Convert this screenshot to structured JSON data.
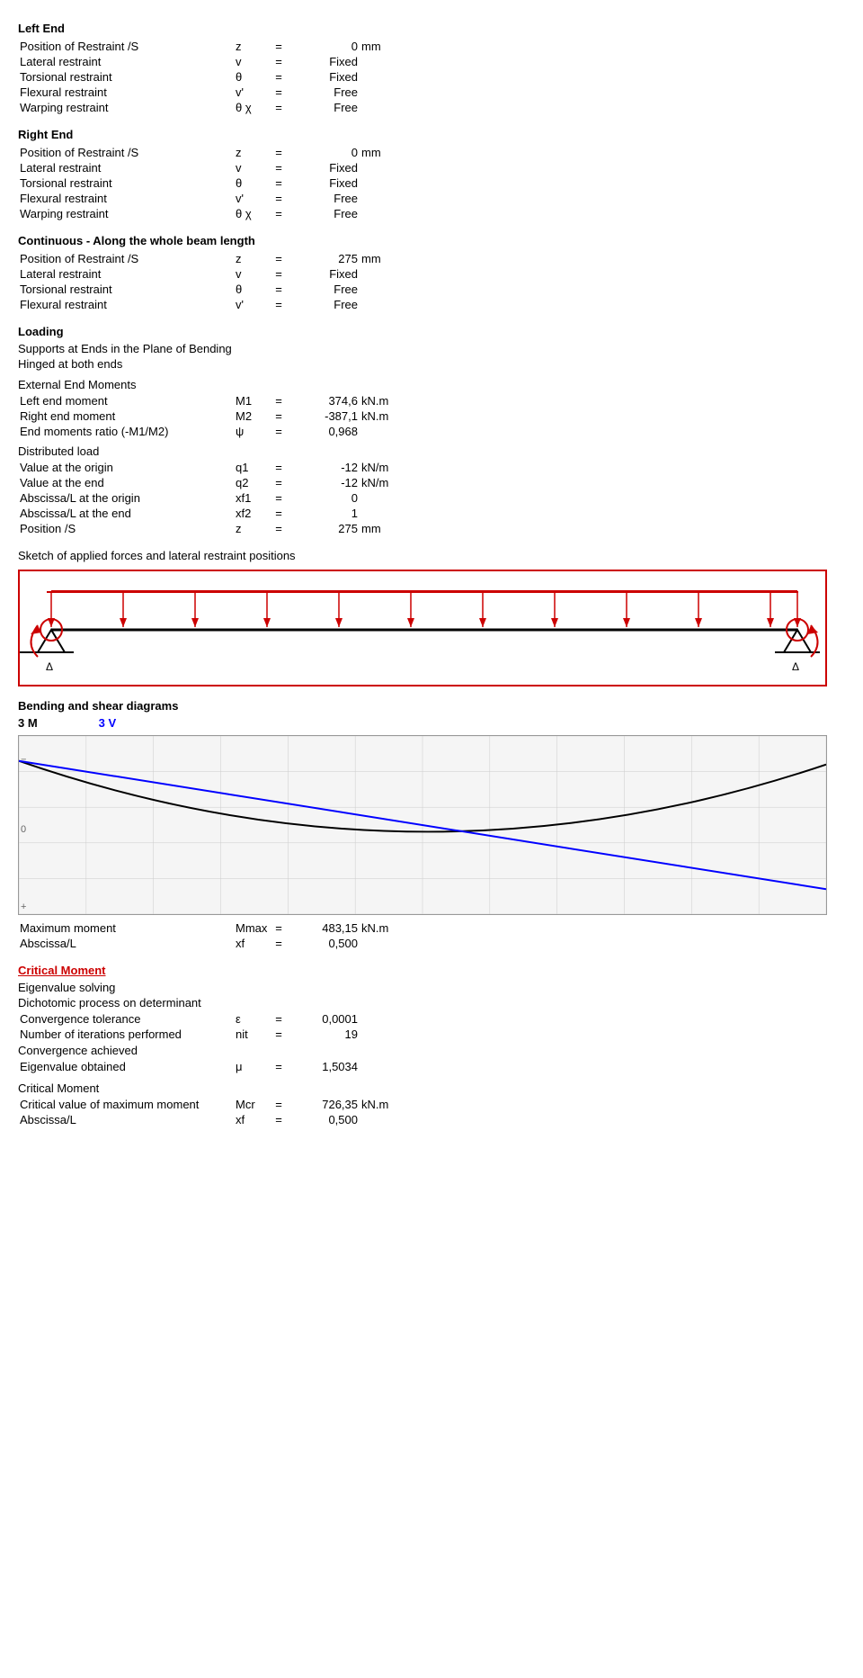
{
  "page": {
    "leftEnd": {
      "header": "Left End",
      "rows": [
        {
          "label": "Position of Restraint /S",
          "symbol": "z",
          "eq": "=",
          "value": "0",
          "unit": "mm"
        },
        {
          "label": "Lateral restraint",
          "symbol": "v",
          "eq": "=",
          "value": "Fixed",
          "unit": ""
        },
        {
          "label": "Torsional restraint",
          "symbol": "θ",
          "eq": "=",
          "value": "Fixed",
          "unit": ""
        },
        {
          "label": "Flexural restraint",
          "symbol": "v'",
          "eq": "=",
          "value": "Free",
          "unit": ""
        },
        {
          "label": "Warping restraint",
          "symbol": "θ χ",
          "eq": "=",
          "value": "Free",
          "unit": ""
        }
      ]
    },
    "rightEnd": {
      "header": "Right End",
      "rows": [
        {
          "label": "Position of Restraint /S",
          "symbol": "z",
          "eq": "=",
          "value": "0",
          "unit": "mm"
        },
        {
          "label": "Lateral restraint",
          "symbol": "v",
          "eq": "=",
          "value": "Fixed",
          "unit": ""
        },
        {
          "label": "Torsional restraint",
          "symbol": "θ",
          "eq": "=",
          "value": "Fixed",
          "unit": ""
        },
        {
          "label": "Flexural restraint",
          "symbol": "v'",
          "eq": "=",
          "value": "Free",
          "unit": ""
        },
        {
          "label": "Warping restraint",
          "symbol": "θ χ",
          "eq": "=",
          "value": "Free",
          "unit": ""
        }
      ]
    },
    "continuous": {
      "header": "Continuous - Along the whole beam length",
      "rows": [
        {
          "label": "Position of Restraint /S",
          "symbol": "z",
          "eq": "=",
          "value": "275",
          "unit": "mm"
        },
        {
          "label": "Lateral restraint",
          "symbol": "v",
          "eq": "=",
          "value": "Fixed",
          "unit": ""
        },
        {
          "label": "Torsional restraint",
          "symbol": "θ",
          "eq": "=",
          "value": "Free",
          "unit": ""
        },
        {
          "label": "Flexural restraint",
          "symbol": "v'",
          "eq": "=",
          "value": "Free",
          "unit": ""
        }
      ]
    },
    "loading": {
      "header": "Loading",
      "supportsHeader": "Supports at Ends in the Plane of Bending",
      "supportsDetail": "Hinged at both ends",
      "externalMomentsHeader": "External End Moments",
      "moments": [
        {
          "label": "Left end moment",
          "symbol": "M1",
          "eq": "=",
          "value": "374,6",
          "unit": "kN.m"
        },
        {
          "label": "Right end moment",
          "symbol": "M2",
          "eq": "=",
          "value": "-387,1",
          "unit": "kN.m"
        },
        {
          "label": "End moments ratio (-M1/M2)",
          "symbol": "ψ",
          "eq": "=",
          "value": "0,968",
          "unit": ""
        }
      ],
      "distributedHeader": "Distributed load",
      "distributed": [
        {
          "label": "Value at the origin",
          "symbol": "q1",
          "eq": "=",
          "value": "-12",
          "unit": "kN/m"
        },
        {
          "label": "Value at the end",
          "symbol": "q2",
          "eq": "=",
          "value": "-12",
          "unit": "kN/m"
        },
        {
          "label": "Abscissa/L at the origin",
          "symbol": "xf1",
          "eq": "=",
          "value": "0",
          "unit": ""
        },
        {
          "label": "Abscissa/L at the end",
          "symbol": "xf2",
          "eq": "=",
          "value": "1",
          "unit": ""
        },
        {
          "label": "Position /S",
          "symbol": "z",
          "eq": "=",
          "value": "275",
          "unit": "mm"
        }
      ]
    },
    "sketch": {
      "header": "Sketch of applied forces and lateral restraint positions"
    },
    "bendingShear": {
      "header": "Bending and shear diagrams",
      "labelM": "3 M",
      "labelV": "3 V",
      "maxMoment": {
        "label": "Maximum moment",
        "symbol": "Mmax",
        "eq": "=",
        "value": "483,15",
        "unit": "kN.m"
      },
      "abscissa": {
        "label": "Abscissa/L",
        "symbol": "xf",
        "eq": "=",
        "value": "0,500",
        "unit": ""
      }
    },
    "criticalMoment": {
      "header": "Critical Moment",
      "eigenvalueHeader": "Eigenvalue solving",
      "dichotomic": "Dichotomic process on determinant",
      "convergence": [
        {
          "label": "Convergence tolerance",
          "symbol": "ε",
          "eq": "=",
          "value": "0,0001",
          "unit": ""
        },
        {
          "label": "Number of iterations performed",
          "symbol": "nit",
          "eq": "=",
          "value": "19",
          "unit": ""
        }
      ],
      "convergenceAchieved": "Convergence achieved",
      "eigenvalue": {
        "label": "Eigenvalue obtained",
        "symbol": "μ",
        "eq": "=",
        "value": "1,5034",
        "unit": ""
      },
      "criticalHeader": "Critical Moment",
      "critical": [
        {
          "label": "Critical value of maximum moment",
          "symbol": "Mcr",
          "eq": "=",
          "value": "726,35",
          "unit": "kN.m"
        },
        {
          "label": "Abscissa/L",
          "symbol": "xf",
          "eq": "=",
          "value": "0,500",
          "unit": ""
        }
      ]
    }
  }
}
